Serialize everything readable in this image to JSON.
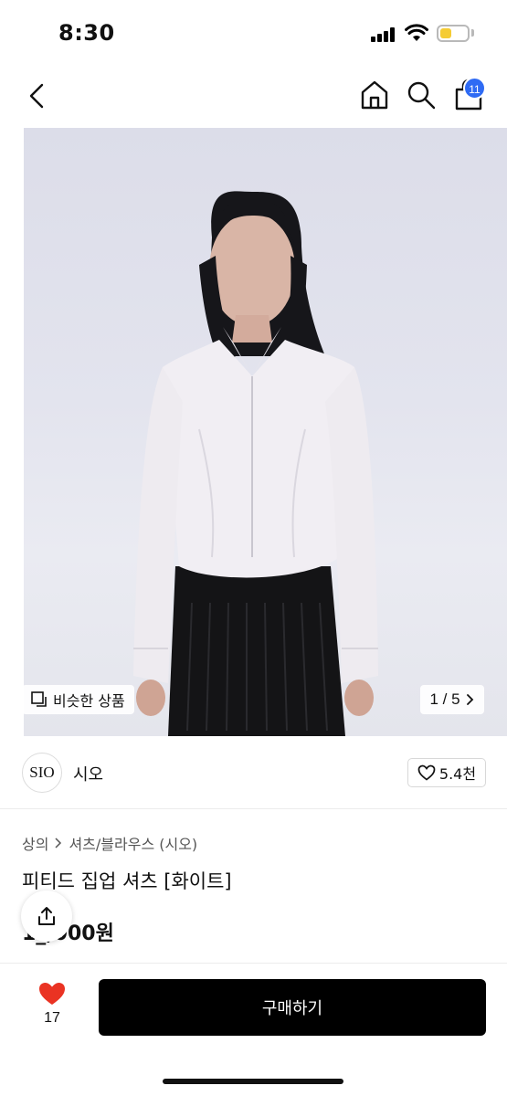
{
  "status_bar": {
    "time": "8:30"
  },
  "nav": {
    "cart_count": "11"
  },
  "gallery": {
    "similar_label": "비슷한 상품",
    "pager": "1 / 5"
  },
  "shop": {
    "logo_text": "SIO",
    "name": "시오",
    "likes": "5.4천"
  },
  "product": {
    "breadcrumb": [
      "상의",
      "셔츠/블라우스 (시오)"
    ],
    "title": "피티드 집업 셔츠 [화이트]",
    "price": "1_,000원"
  },
  "bottom_bar": {
    "wish_count": "17",
    "buy_label": "구매하기"
  },
  "colors": {
    "accent_badge": "#2f6bf4",
    "heart": "#ea3323",
    "buy_button": "#000000"
  }
}
